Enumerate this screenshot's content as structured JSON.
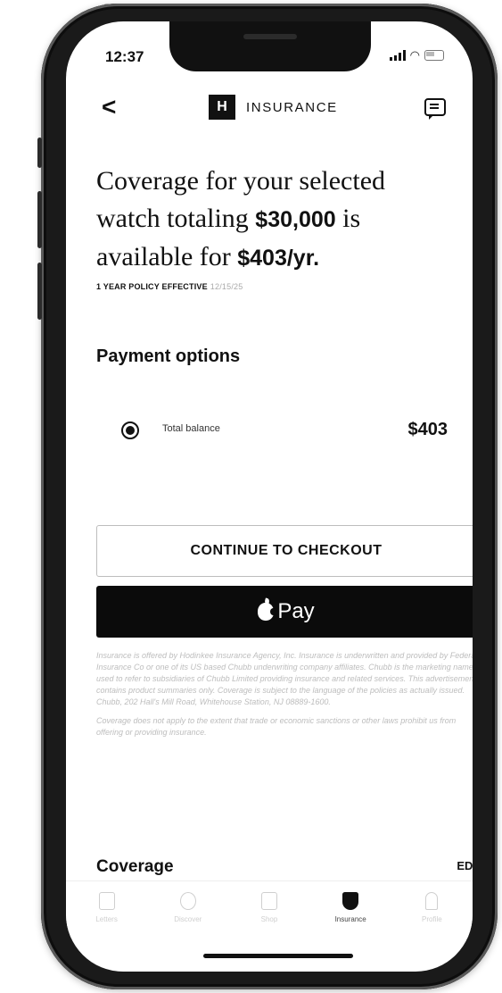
{
  "status_bar": {
    "time": "12:37"
  },
  "navbar": {
    "back_glyph": "<",
    "logo_letter": "H",
    "title": "INSURANCE",
    "chat_icon": "chat-icon"
  },
  "offer": {
    "line1": "Coverage for your selected",
    "line2_pre": "watch totaling ",
    "amount": "$30,000",
    "line2_post": " is",
    "line3_pre": "available for ",
    "price": "$403/yr.",
    "policy_label": "1 YEAR POLICY EFFECTIVE",
    "policy_date": "12/15/25"
  },
  "payment": {
    "title": "Payment options",
    "option_label": "Total balance",
    "option_amount": "$403",
    "selected": true
  },
  "buttons": {
    "checkout": "CONTINUE TO CHECKOUT",
    "apple_pay": "Pay"
  },
  "disclaimer": {
    "p1": "Insurance is offered by Hodinkee Insurance Agency, Inc. Insurance is underwritten and provided by Federal Insurance Co or one of its US based Chubb underwriting company affiliates. Chubb is the marketing name used to refer to subsidiaries of Chubb Limited providing insurance and related services. This advertisement contains product summaries only. Coverage is subject to the language of the policies as actually issued. Chubb, 202 Hall's Mill Road, Whitehouse Station, NJ 08889-1600.",
    "p2": "Coverage does not apply to the extent that trade or economic sanctions or other laws prohibit us from offering or providing insurance."
  },
  "coverage": {
    "title": "Coverage",
    "edit": "EDIT"
  },
  "tabbar": {
    "items": [
      {
        "label": "Letters",
        "icon": "document-icon"
      },
      {
        "label": "Discover",
        "icon": "watch-icon"
      },
      {
        "label": "Shop",
        "icon": "shop-icon"
      },
      {
        "label": "Insurance",
        "icon": "shield-icon",
        "active": true
      },
      {
        "label": "Profile",
        "icon": "person-icon"
      }
    ]
  }
}
